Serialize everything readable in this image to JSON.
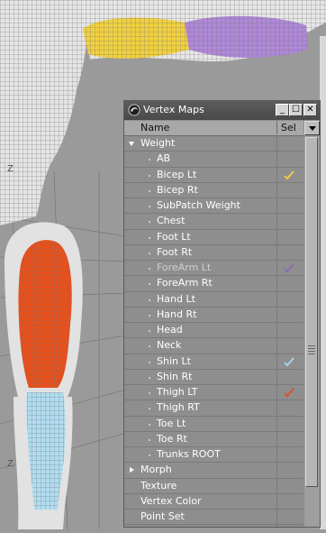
{
  "window": {
    "title": "Vertex Maps",
    "buttons": [
      "minimize",
      "maximize",
      "close"
    ]
  },
  "columns": {
    "name": "Name",
    "sel": "Sel"
  },
  "rows": [
    {
      "label": "Weight",
      "kind": "category",
      "expanded": true
    },
    {
      "label": "AB",
      "kind": "item"
    },
    {
      "label": "Bicep Lt",
      "kind": "item",
      "check_color": "#f0d040"
    },
    {
      "label": "Bicep Rt",
      "kind": "item"
    },
    {
      "label": "SubPatch Weight",
      "kind": "item"
    },
    {
      "label": "Chest",
      "kind": "item"
    },
    {
      "label": "Foot Lt",
      "kind": "item"
    },
    {
      "label": "Foot Rt",
      "kind": "item"
    },
    {
      "label": "ForeArm Lt",
      "kind": "item",
      "check_color": "#9068b8",
      "dimmed": true
    },
    {
      "label": "ForeArm Rt",
      "kind": "item"
    },
    {
      "label": "Hand Lt",
      "kind": "item"
    },
    {
      "label": "Hand Rt",
      "kind": "item"
    },
    {
      "label": "Head",
      "kind": "item"
    },
    {
      "label": "Neck",
      "kind": "item"
    },
    {
      "label": "Shin Lt",
      "kind": "item",
      "check_color": "#a8d8f0"
    },
    {
      "label": "Shin Rt",
      "kind": "item"
    },
    {
      "label": "Thigh LT",
      "kind": "item",
      "check_color": "#e05020"
    },
    {
      "label": "Thigh RT",
      "kind": "item"
    },
    {
      "label": "Toe Lt",
      "kind": "item"
    },
    {
      "label": "Toe Rt",
      "kind": "item"
    },
    {
      "label": "Trunks ROOT",
      "kind": "item"
    },
    {
      "label": "Morph",
      "kind": "category",
      "expanded": false
    },
    {
      "label": "Texture",
      "kind": "top"
    },
    {
      "label": "Vertex Color",
      "kind": "top"
    },
    {
      "label": "Point Set",
      "kind": "top"
    }
  ],
  "viewport": {
    "colors": {
      "background": "#9a9a9a",
      "wire_mesh": "#e8e8e8",
      "bicep_map": "#f0d040",
      "forearm_map": "#b088d8",
      "thigh_map": "#e8501c",
      "shin_map": "#b0dcf0",
      "grid": "#6a6a6a"
    },
    "grid_labels": [
      "Z",
      "Z"
    ]
  }
}
